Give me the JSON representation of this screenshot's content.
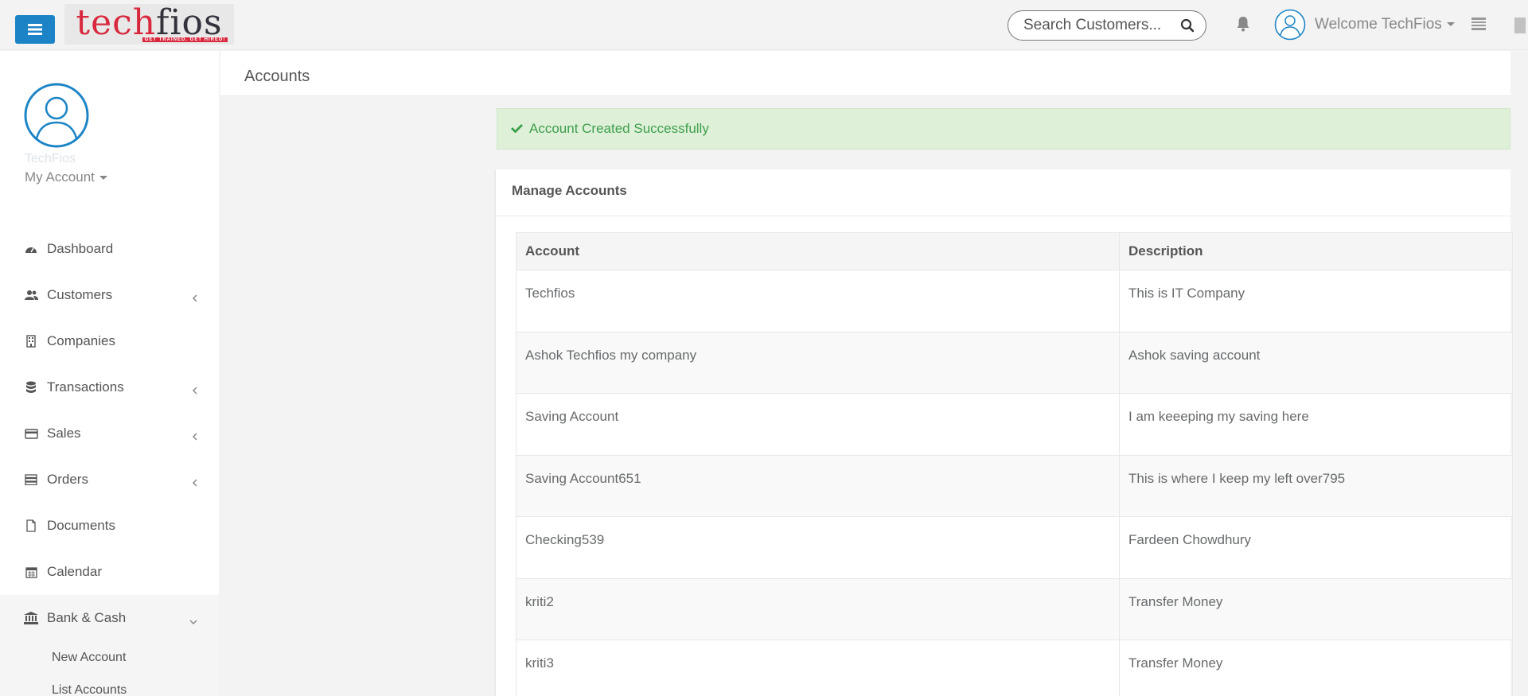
{
  "header": {
    "logo": {
      "text_red": "tech",
      "text_dark": "fios",
      "tagline": "GET TRAINED. GET HIRED!"
    },
    "search": {
      "placeholder": "Search Customers...",
      "value": ""
    },
    "welcome": "Welcome TechFios",
    "colors": {
      "accent": "#1c84c6",
      "logo_red": "#d9283d"
    }
  },
  "sidebar": {
    "profile_name": "TechFios",
    "my_account": "My Account",
    "items": [
      {
        "label": "Dashboard",
        "icon": "dashboard-icon",
        "has_arrow": false
      },
      {
        "label": "Customers",
        "icon": "users-icon",
        "has_arrow": true
      },
      {
        "label": "Companies",
        "icon": "building-icon",
        "has_arrow": false
      },
      {
        "label": "Transactions",
        "icon": "database-icon",
        "has_arrow": true
      },
      {
        "label": "Sales",
        "icon": "credit-card-icon",
        "has_arrow": true
      },
      {
        "label": "Orders",
        "icon": "server-icon",
        "has_arrow": true
      },
      {
        "label": "Documents",
        "icon": "file-icon",
        "has_arrow": false
      },
      {
        "label": "Calendar",
        "icon": "calendar-icon",
        "has_arrow": false
      },
      {
        "label": "Bank & Cash",
        "icon": "bank-icon",
        "has_arrow": true,
        "expanded": true
      }
    ],
    "sub_items": [
      "New Account",
      "List Accounts"
    ]
  },
  "page": {
    "title": "Accounts",
    "alert": "Account Created Successfully",
    "panel_title": "Manage Accounts",
    "table": {
      "headers": [
        "Account",
        "Description"
      ],
      "rows": [
        [
          "Techfios",
          "This is IT Company"
        ],
        [
          "Ashok Techfios my company",
          "Ashok saving account"
        ],
        [
          "Saving Account",
          "I am keeeping my saving here"
        ],
        [
          "Saving Account651",
          "This is where I keep my left over795"
        ],
        [
          "Checking539",
          "Fardeen Chowdhury"
        ],
        [
          "kriti2",
          "Transfer Money"
        ],
        [
          "kriti3",
          "Transfer Money"
        ]
      ]
    }
  }
}
